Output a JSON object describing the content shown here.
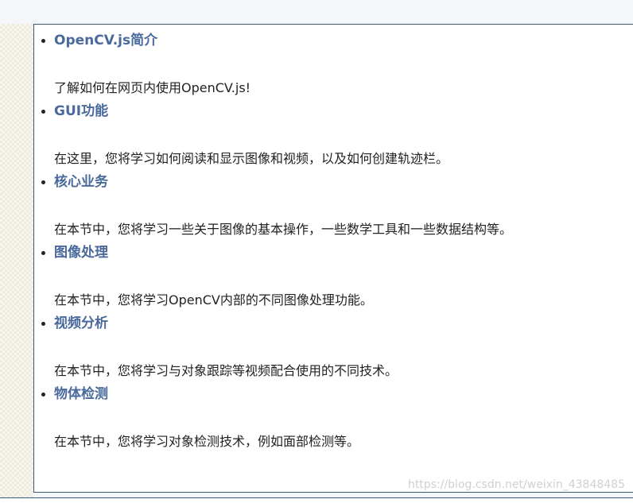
{
  "modules": [
    {
      "title": "OpenCV.js简介",
      "description": "了解如何在网页内使用OpenCV.js!"
    },
    {
      "title": "GUI功能",
      "description": "在这里，您将学习如何阅读和显示图像和视频，以及如何创建轨迹栏。"
    },
    {
      "title": "核心业务",
      "description": "在本节中，您将学习一些关于图像的基本操作，一些数学工具和一些数据结构等。"
    },
    {
      "title": "图像处理",
      "description": "在本节中，您将学习OpenCV内部的不同图像处理功能。"
    },
    {
      "title": "视频分析",
      "description": "在本节中，您将学习与对象跟踪等视频配合使用的不同技术。"
    },
    {
      "title": "物体检测",
      "description": "在本节中，您将学习对象检测技术，例如面部检测等。"
    }
  ],
  "watermark": "https://blog.csdn.net/weixin_43848485",
  "colors": {
    "link": "#4a6a9c",
    "text": "#222222",
    "border": "#3a5a7e"
  }
}
